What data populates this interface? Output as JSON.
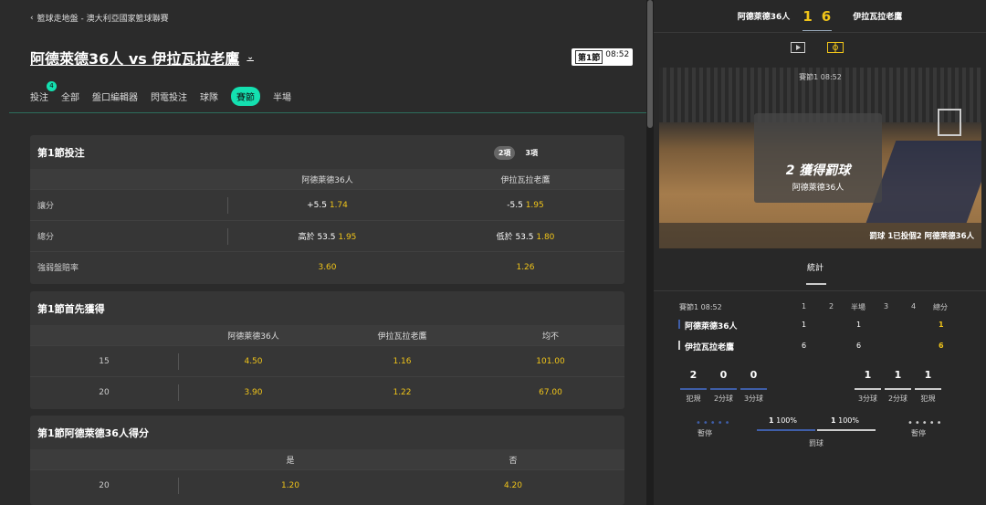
{
  "breadcrumb": "籃球走地盤 - 澳大利亞國家籃球聯賽",
  "match_title": "阿德萊德36人 vs 伊拉瓦拉老鷹",
  "clock": {
    "period": "第1節",
    "time": "08:52"
  },
  "tabs": [
    {
      "label": "投注",
      "badge": "4"
    },
    {
      "label": "全部"
    },
    {
      "label": "盤口編輯器"
    },
    {
      "label": "閃電投注"
    },
    {
      "label": "球隊"
    },
    {
      "label": "賽節",
      "active": true
    },
    {
      "label": "半場"
    }
  ],
  "section1": {
    "title": "第1節投注",
    "toggle": [
      "2項",
      "3項"
    ],
    "cols": [
      "阿德萊德36人",
      "伊拉瓦拉老鷹"
    ],
    "rows": [
      {
        "label": "讓分",
        "h_line": "+5.5",
        "h_odds": "1.74",
        "a_line": "-5.5",
        "a_odds": "1.95"
      },
      {
        "label": "總分",
        "h_line": "高於 53.5",
        "h_odds": "1.95",
        "a_line": "低於 53.5",
        "a_odds": "1.80"
      },
      {
        "label": "強弱盤賠率",
        "h_line": "",
        "h_odds": "3.60",
        "a_line": "",
        "a_odds": "1.26"
      }
    ]
  },
  "section2": {
    "title": "第1節首先獲得",
    "cols": [
      "阿德萊德36人",
      "伊拉瓦拉老鷹",
      "均不"
    ],
    "rows": [
      {
        "label": "15",
        "v": [
          "4.50",
          "1.16",
          "101.00"
        ]
      },
      {
        "label": "20",
        "v": [
          "3.90",
          "1.22",
          "67.00"
        ]
      }
    ]
  },
  "section3": {
    "title": "第1節阿德萊德36人得分",
    "cols": [
      "是",
      "否"
    ],
    "rows": [
      {
        "label": "20",
        "v": [
          "1.20",
          "4.20"
        ]
      }
    ]
  },
  "score": {
    "home": "阿德萊德36人",
    "away": "伊拉瓦拉老鷹",
    "home_score": "1",
    "away_score": "6"
  },
  "live": {
    "header": "賽節1 08:52",
    "event": "2 獲得罰球",
    "team": "阿德萊德36人",
    "footer": "罰球 1已投個2  阿德萊德36人"
  },
  "stats": {
    "tab": "統計",
    "period_label": "賽節1",
    "time": "08:52",
    "cols": [
      "1",
      "2",
      "半場",
      "3",
      "4",
      "總分"
    ],
    "home": {
      "name": "阿德萊德36人",
      "v": [
        "1",
        "",
        "1",
        "",
        "",
        "1"
      ]
    },
    "away": {
      "name": "伊拉瓦拉老鷹",
      "v": [
        "6",
        "",
        "6",
        "",
        "",
        "6"
      ]
    },
    "home_boxes": [
      {
        "n": "2",
        "l": "犯規"
      },
      {
        "n": "0",
        "l": "2分球"
      },
      {
        "n": "0",
        "l": "3分球"
      }
    ],
    "away_boxes": [
      {
        "n": "1",
        "l": "3分球"
      },
      {
        "n": "1",
        "l": "2分球"
      },
      {
        "n": "1",
        "l": "犯規"
      }
    ],
    "timeout_label": "暫停",
    "ft": {
      "home": "1",
      "home_pct": "100%",
      "away": "1",
      "away_pct": "100%",
      "label": "罰球"
    }
  }
}
